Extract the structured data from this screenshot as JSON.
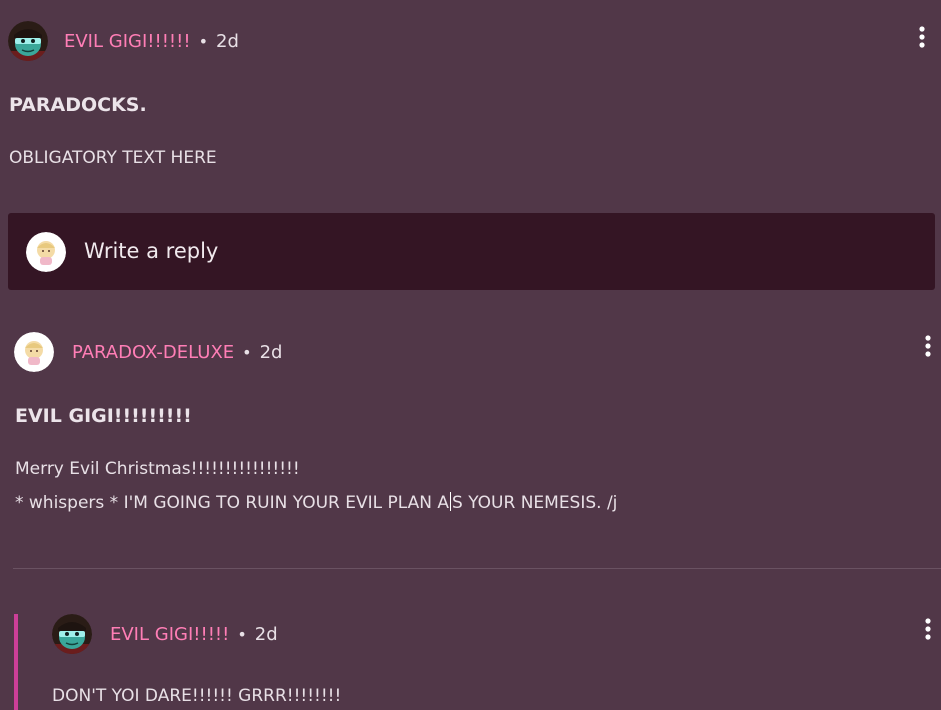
{
  "colors": {
    "background": "#513748",
    "reply_box": "#341524",
    "username": "#ff7eb6",
    "thread_bar": "#cc3f98",
    "text": "#e8e0e6"
  },
  "post": {
    "author": "EVIL GIGI!!!!!!",
    "separator": "•",
    "age": "2d",
    "title": "PARADOCKS.",
    "body": "OBLIGATORY TEXT HERE",
    "avatar_icon": "teal-villain-avatar",
    "menu_icon": "vertical-dots-icon"
  },
  "reply_box": {
    "placeholder": "Write a reply",
    "avatar_icon": "chibi-character-avatar"
  },
  "comments": [
    {
      "author": "PARADOX-DELUXE",
      "separator": "•",
      "age": "2d",
      "title": "EVIL GIGI!!!!!!!!!",
      "lines": [
        "Merry Evil Christmas!!!!!!!!!!!!!!!!",
        "* whispers * I'M GOING TO RUIN YOUR EVIL PLAN A",
        "S YOUR NEMESIS. /j"
      ],
      "avatar_icon": "chibi-character-avatar"
    },
    {
      "author": "EVIL GIGI!!!!!",
      "separator": "•",
      "age": "2d",
      "body": "DON'T YOI DARE!!!!!! GRRR!!!!!!!!",
      "avatar_icon": "teal-villain-avatar"
    }
  ]
}
